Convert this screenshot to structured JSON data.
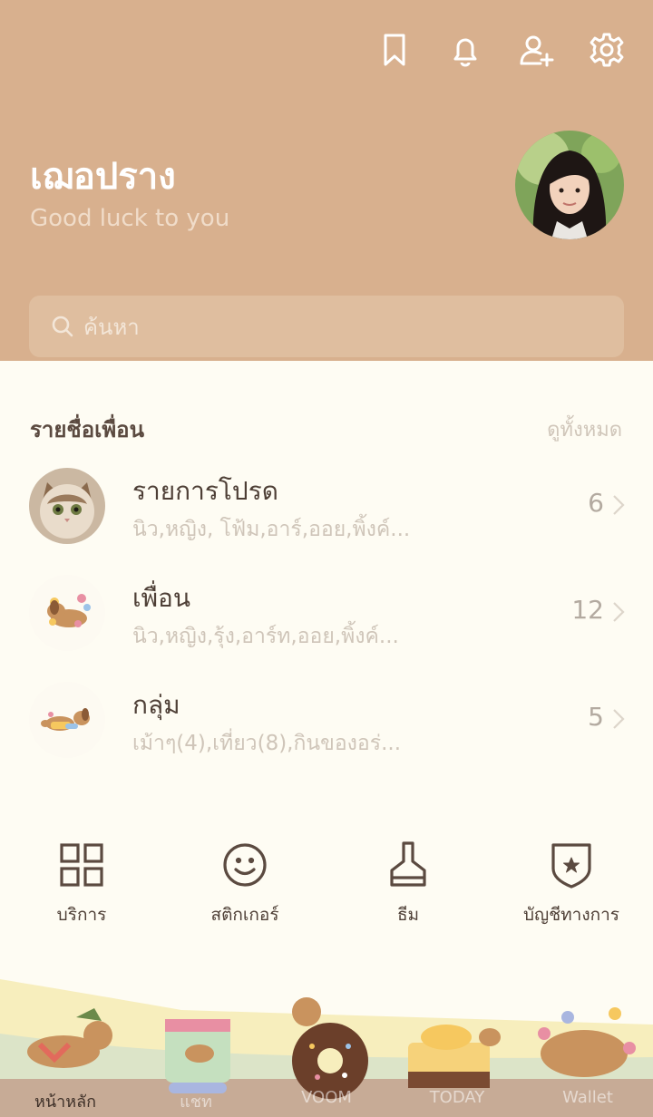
{
  "header": {
    "profile_name": "เฌอปราง",
    "status_message": "Good luck to you",
    "icons": [
      "bookmark-icon",
      "bell-icon",
      "add-friend-icon",
      "settings-icon"
    ]
  },
  "search": {
    "placeholder": "ค้นหา"
  },
  "friends_section": {
    "title": "รายชื่อเพื่อน",
    "view_all": "ดูทั้งหมด",
    "rows": [
      {
        "title": "รายการโปรด",
        "subtitle": "นิว,หญิง, โฟ้ม,อาร์,ออย,พิ้งค์...",
        "count": "6"
      },
      {
        "title": "เพื่อน",
        "subtitle": "นิว,หญิง,รุ้ง,อาร์ท,ออย,พิ้งค์...",
        "count": "12"
      },
      {
        "title": "กลุ่ม",
        "subtitle": "เม้าๆ(4),เที่ยว(8),กินของอร่...",
        "count": "5"
      }
    ]
  },
  "quick_actions": [
    {
      "label": "บริการ",
      "icon": "grid-icon"
    },
    {
      "label": "สติกเกอร์",
      "icon": "smiley-icon"
    },
    {
      "label": "ธีม",
      "icon": "brush-icon"
    },
    {
      "label": "บัญชีทางการ",
      "icon": "shield-star-icon"
    }
  ],
  "tabbar": {
    "tabs": [
      "หน้าหลัก",
      "แชท",
      "VOOM",
      "TODAY",
      "Wallet"
    ]
  },
  "colors": {
    "header": "#d8b08e",
    "background": "#fefcf3",
    "text": "#4e3f36"
  }
}
